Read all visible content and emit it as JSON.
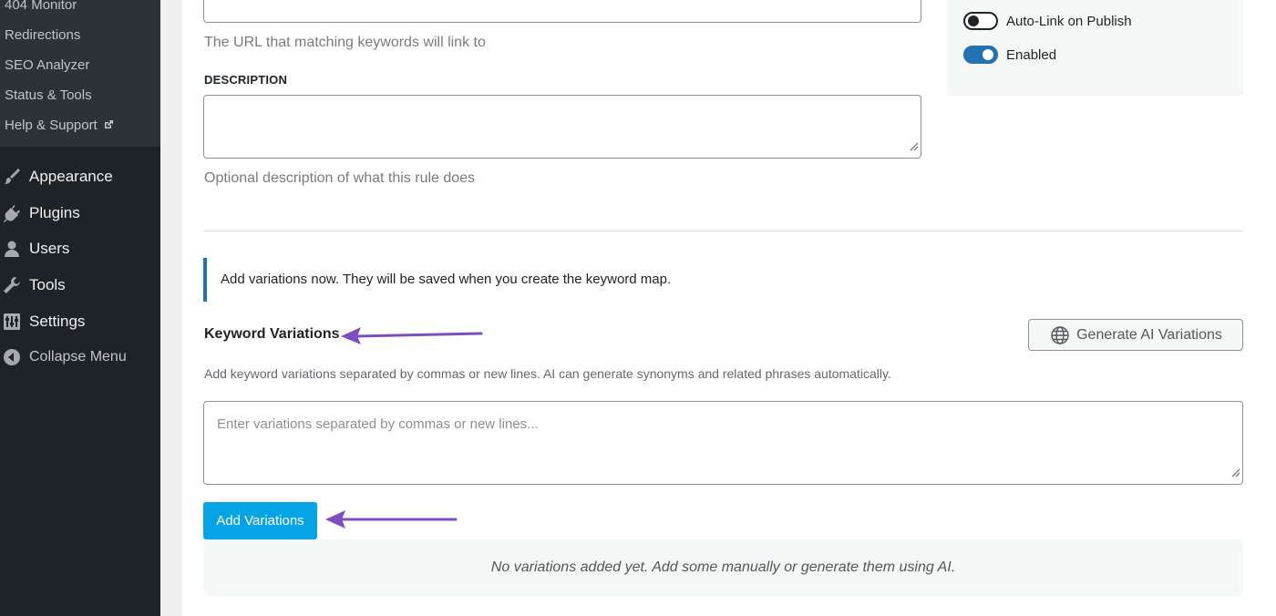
{
  "sidebar": {
    "submenu": [
      {
        "label": "404 Monitor"
      },
      {
        "label": "Redirections"
      },
      {
        "label": "SEO Analyzer"
      },
      {
        "label": "Status & Tools"
      },
      {
        "label": "Help & Support",
        "icon": "external-link-icon"
      }
    ],
    "menu": [
      {
        "label": "Appearance",
        "icon": "paintbrush-icon"
      },
      {
        "label": "Plugins",
        "icon": "plug-icon"
      },
      {
        "label": "Users",
        "icon": "user-icon"
      },
      {
        "label": "Tools",
        "icon": "wrench-icon"
      },
      {
        "label": "Settings",
        "icon": "sliders-icon"
      },
      {
        "label": "Collapse Menu",
        "icon": "collapse-arrow-icon"
      }
    ]
  },
  "form": {
    "url_help": "The URL that matching keywords will link to",
    "description_label": "DESCRIPTION",
    "description_help": "Optional description of what this rule does",
    "notice": "Add variations now. They will be saved when you create the keyword map.",
    "variations_title": "Keyword Variations",
    "generate_button": "Generate AI Variations",
    "variations_desc": "Add keyword variations separated by commas or new lines. AI can generate synonyms and related phrases automatically.",
    "variations_placeholder": "Enter variations separated by commas or new lines...",
    "add_button": "Add Variations",
    "empty_message": "No variations added yet. Add some manually or generate them using AI."
  },
  "settings": {
    "toggles": [
      {
        "label": "Auto-Link on Publish",
        "state": "off"
      },
      {
        "label": "Enabled",
        "state": "on"
      }
    ]
  },
  "colors": {
    "accent": "#2271b1",
    "add_button": "#06a4e5",
    "annotation_arrow": "#7b4fc2"
  }
}
